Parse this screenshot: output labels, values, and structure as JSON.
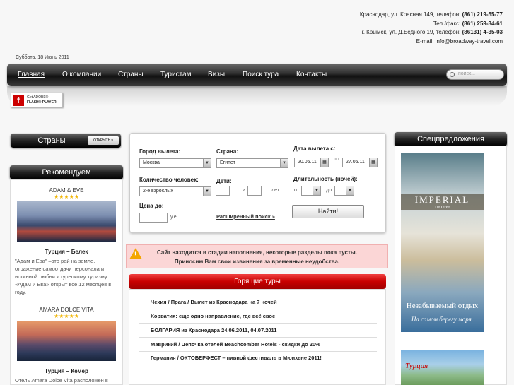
{
  "contacts": {
    "line1_prefix": "г. Краснодар, ул. Красная 149, телефон:",
    "line1_phone": "(861) 219-55-77",
    "line2_prefix": "Тел./факс:",
    "line2_phone": "(861) 259-34-61",
    "line3_prefix": "г. Крымск, ул. Д.Бедного 19, телефон:",
    "line3_phone": "(86131) 4-35-03",
    "email": "E-mail: info@broadway-travel.com"
  },
  "date": "Суббота, 18 Июнь 2011",
  "nav": {
    "items": [
      "Главная",
      "О компании",
      "Страны",
      "Туристам",
      "Визы",
      "Поиск тура",
      "Контакты"
    ],
    "search_placeholder": "поиск..."
  },
  "flash": {
    "line1": "Get ADOBE®",
    "line2": "FLASH® PLAYER",
    "icon": "f"
  },
  "countries": {
    "title": "Страны",
    "open_label": "ОТКРЫТЬ"
  },
  "recommend": {
    "title": "Рекомендуем",
    "hotels": [
      {
        "name": "ADAM & EVE",
        "stars": "★★★★★",
        "country": "Турция – Белек",
        "desc": "\"Адам и Ева\" –это рай на земле, отражение самоотдачи персонала и истинной любви к турецкому туризму. «Адам и Ева» открыт все 12 месяцев в году."
      },
      {
        "name": "AMARA DOLCE VITA",
        "stars": "★★★★★",
        "country": "Турция – Кемер",
        "desc": "Отель Amara Dolce Vita расположен в уникальном живописном уголке Турции, где гостям будут"
      }
    ]
  },
  "form": {
    "depart_label": "Город вылета:",
    "depart_value": "Москва",
    "country_label": "Страна:",
    "country_value": "Египет",
    "date_label": "Дата вылета с:",
    "date_from": "20.06.11",
    "date_to_label": "по",
    "date_to": "27.06.11",
    "people_label": "Количество человек:",
    "people_value": "2-е взрослых",
    "children_label": "Дети:",
    "and_label": "и",
    "years_label": "лет",
    "duration_label": "Длительность (ночей):",
    "from_label": "от",
    "to_label": "до",
    "price_label": "Цена до:",
    "currency_label": "у.е.",
    "advanced_label": "Расширенный поиск »",
    "find_label": "Найти!"
  },
  "notice": {
    "line1": "Сайт находится в стадии наполнения, некоторые разделы пока пусты.",
    "line2": "Приносим Вам свои извинения за временные неудобства."
  },
  "hot_tours": {
    "title": "Горящие туры",
    "items": [
      "Чехия / Прага / Вылет из Краснодара на 7 ночей",
      "Хорватия: еще одно направление, где всё свое",
      "БОЛГАРИЯ из Краснодара 24.06.2011, 04.07.2011",
      "Маврикий / Цепочка отелей Beachcomber Hotels - скидки до 20%",
      "Германия / ОКТОБЕРФЕСТ – пивной фестиваль в Мюнхене 2011!"
    ]
  },
  "special": {
    "title": "Спецпредложения",
    "ad1_brand": "IMPERIAL",
    "ad1_sub": "De Luxe",
    "ad1_tag1": "Незабываемый отдых",
    "ad1_tag2": "На самом берегу моря.",
    "ad2_brand": "Турция"
  }
}
